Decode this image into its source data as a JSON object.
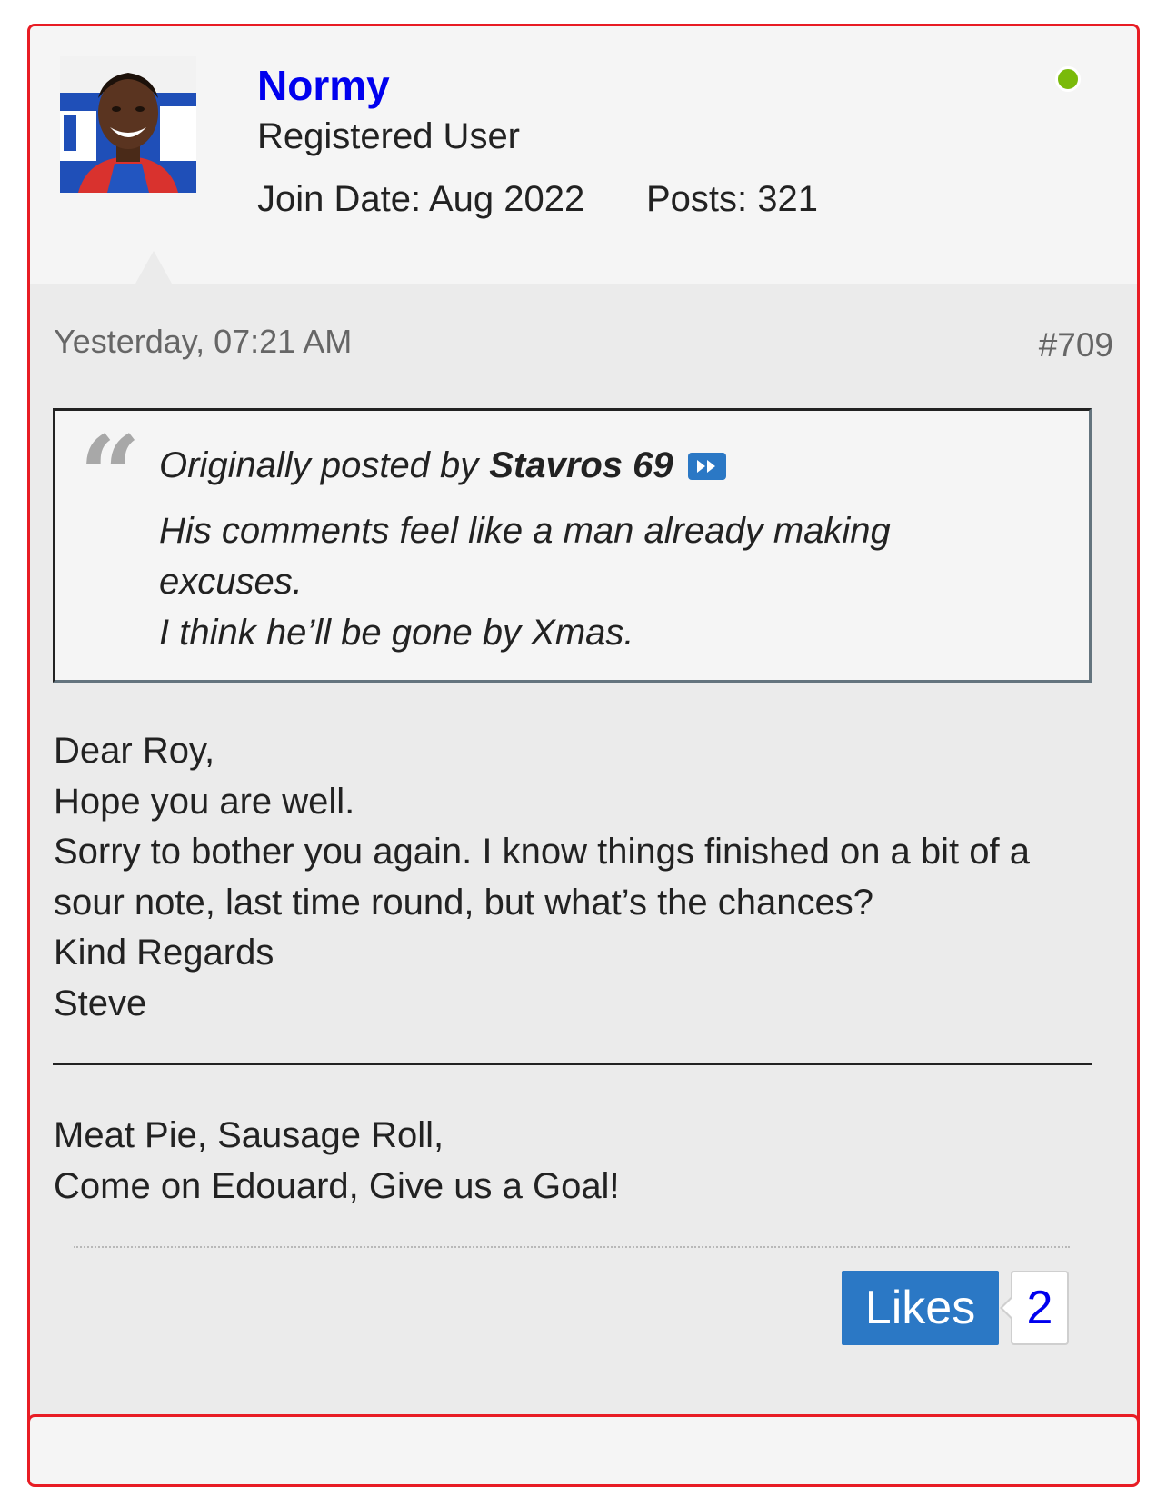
{
  "colors": {
    "post_border": "#e81c24",
    "username": "#0000ee",
    "online_indicator": "#7aba0a",
    "likes_button": "#2b78c5",
    "likes_count_text": "#0000ee"
  },
  "user": {
    "username": "Normy",
    "title": "Registered User",
    "join_date": "Join Date: Aug 2022",
    "posts": "Posts: 321",
    "online": true
  },
  "post": {
    "timestamp": "Yesterday, 07:21 AM",
    "number": "#709",
    "quote": {
      "mark": "“",
      "prefix": "Originally posted by",
      "author": "Stavros 69",
      "icon": "view-post-icon",
      "lines": [
        "His comments feel like a man already making excuses.",
        "I think he’ll be gone by Xmas."
      ]
    },
    "message": [
      "Dear Roy,",
      "Hope you are well.",
      "Sorry to bother you again. I know things finished on a bit of a sour note, last time round, but what’s the chances?",
      "Kind Regards",
      "Steve"
    ],
    "signature": [
      "Meat Pie, Sausage Roll,",
      "Come on Edouard, Give us a Goal!"
    ],
    "likes_label": "Likes",
    "likes_count": "2"
  }
}
